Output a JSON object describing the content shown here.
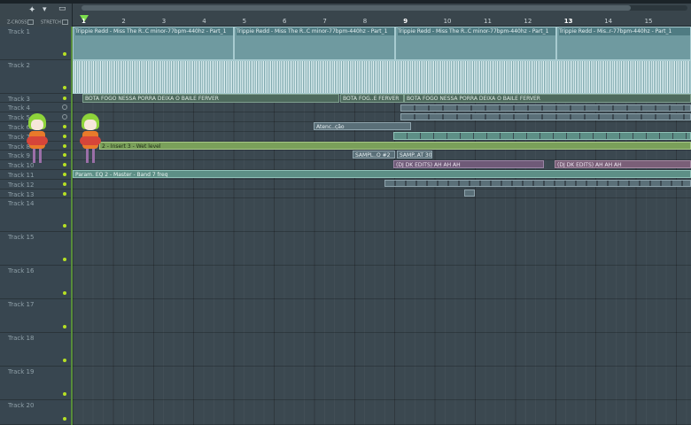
{
  "toolbar": {
    "label_zcross": "Z-CROSS",
    "label_stretch": "STRETCH",
    "colors": {
      "accent": "#7ee04e",
      "mute_dot": "#b6e024"
    }
  },
  "ruler": {
    "bars": [
      "1",
      "2",
      "3",
      "4",
      "5",
      "6",
      "7",
      "8",
      "9",
      "10",
      "11",
      "12",
      "13",
      "14",
      "15"
    ]
  },
  "tracks": [
    "Track 1",
    "Track 2",
    "Track 3",
    "Track 4",
    "Track 5",
    "Track 6",
    "Track 7",
    "Track 8",
    "Track 9",
    "Track 10",
    "Track 11",
    "Track 12",
    "Track 13",
    "Track 14",
    "Track 15",
    "Track 16",
    "Track 17",
    "Track 18",
    "Track 19",
    "Track 20"
  ],
  "clips": {
    "trippie_a": "Trippie Redd - Miss The R..C minor-77bpm-440hz - Part_1",
    "trippie_b": "Trippie Redd - Miss The R..C minor-77bpm-440hz - Part_1",
    "trippie_c": "Trippie Redd - Miss The R..C minor-77bpm-440hz - Part_1",
    "trippie_d": "Trippie Redd - Mis..r-77bpm-440hz - Part_1",
    "bota_a": "BOTA FOGO NESSA PORRA DEIXA O BAILE FERVER",
    "bota_b": "BOTA FOG..E FERVER",
    "bota_c": "BOTA FOGO NESSA PORRA DEIXA O BAILE FERVER",
    "atencao": "Atenc..ção",
    "insert": "2 - Insert 3 - Wet level",
    "sample_a": "SAMPL..O #2",
    "sample_b": "SAMP..AT 30",
    "dj_a": "(DJ DK EDITS) AH AH AH",
    "dj_b": "(DJ DK EDITS) AH AH AH",
    "param": "Param. EQ 2 - Master - Band 7 freq"
  }
}
